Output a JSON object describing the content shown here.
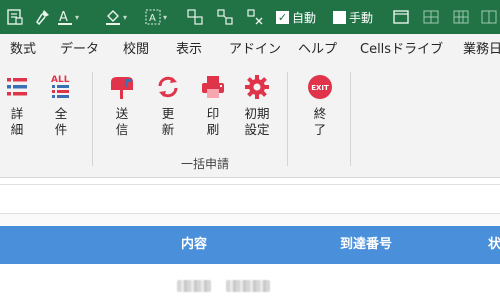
{
  "qat": {
    "checkbox_auto": {
      "label": "自動",
      "checked": true
    },
    "checkbox_manual": {
      "label": "手動",
      "checked": false
    }
  },
  "tabs": [
    "数式",
    "データ",
    "校閲",
    "表示",
    "アドイン",
    "ヘルプ",
    "Cellsドライブ",
    "業務日"
  ],
  "ribbon": {
    "buttons": [
      {
        "label": "詳\n細",
        "icon": "list-detail-icon"
      },
      {
        "label": "全\n件",
        "icon": "all-list-icon"
      },
      {
        "label": "送\n信",
        "icon": "send-mailbox-icon"
      },
      {
        "label": "更\n新",
        "icon": "refresh-icon"
      },
      {
        "label": "印\n刷",
        "icon": "print-icon"
      },
      {
        "label": "初期\n設定",
        "icon": "gear-icon"
      },
      {
        "label": "終\n了",
        "icon": "exit-icon"
      }
    ],
    "group_label": "一括申請",
    "exit_badge_text": "EXIT",
    "all_badge_text": "ALL"
  },
  "table": {
    "headers": [
      "内容",
      "到達番号",
      "状"
    ]
  },
  "colors": {
    "title_bar": "#217346",
    "ribbon_bg": "#f3f3f3",
    "header_blue": "#4a8fd9",
    "icon_red": "#e0344a"
  }
}
